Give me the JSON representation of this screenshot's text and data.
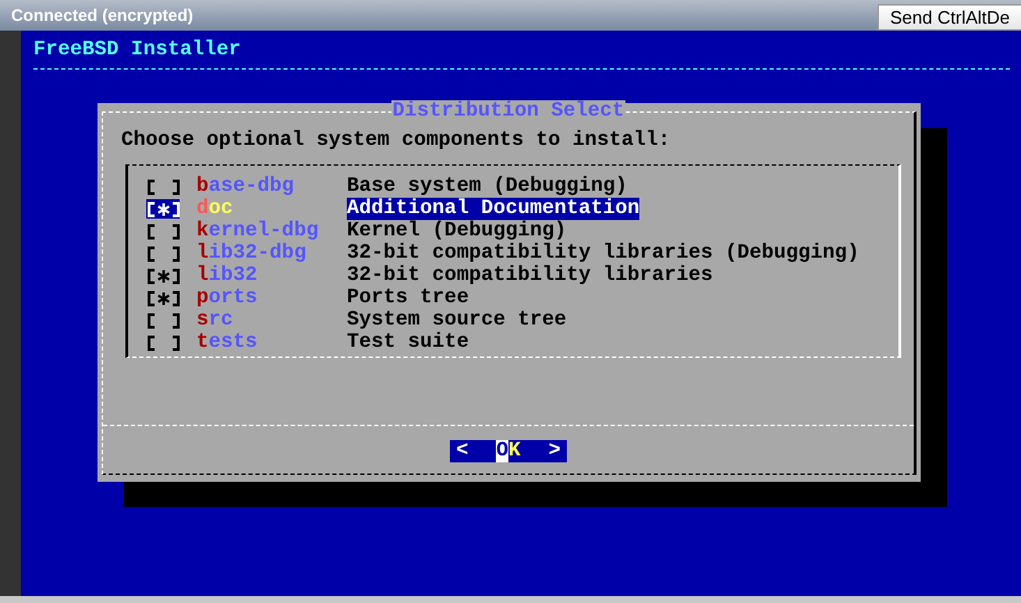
{
  "connection_bar": {
    "status": "Connected (encrypted)",
    "button": "Send CtrlAltDe"
  },
  "screen": {
    "title": "FreeBSD Installer"
  },
  "dialog": {
    "title": "Distribution Select",
    "prompt": "Choose optional system components to install:",
    "items": [
      {
        "name": "base-dbg",
        "description": "Base system (Debugging)",
        "checked": false,
        "selected": false
      },
      {
        "name": "doc",
        "description": "Additional Documentation",
        "checked": true,
        "selected": true
      },
      {
        "name": "kernel-dbg",
        "description": "Kernel (Debugging)",
        "checked": false,
        "selected": false
      },
      {
        "name": "lib32-dbg",
        "description": "32-bit compatibility libraries (Debugging)",
        "checked": false,
        "selected": false
      },
      {
        "name": "lib32",
        "description": "32-bit compatibility libraries",
        "checked": true,
        "selected": false
      },
      {
        "name": "ports",
        "description": "Ports tree",
        "checked": true,
        "selected": false
      },
      {
        "name": "src",
        "description": "System source tree",
        "checked": false,
        "selected": false
      },
      {
        "name": "tests",
        "description": "Test suite",
        "checked": false,
        "selected": false
      }
    ],
    "buttons": [
      {
        "left": "<",
        "label": "OK",
        "right": ">"
      }
    ]
  }
}
